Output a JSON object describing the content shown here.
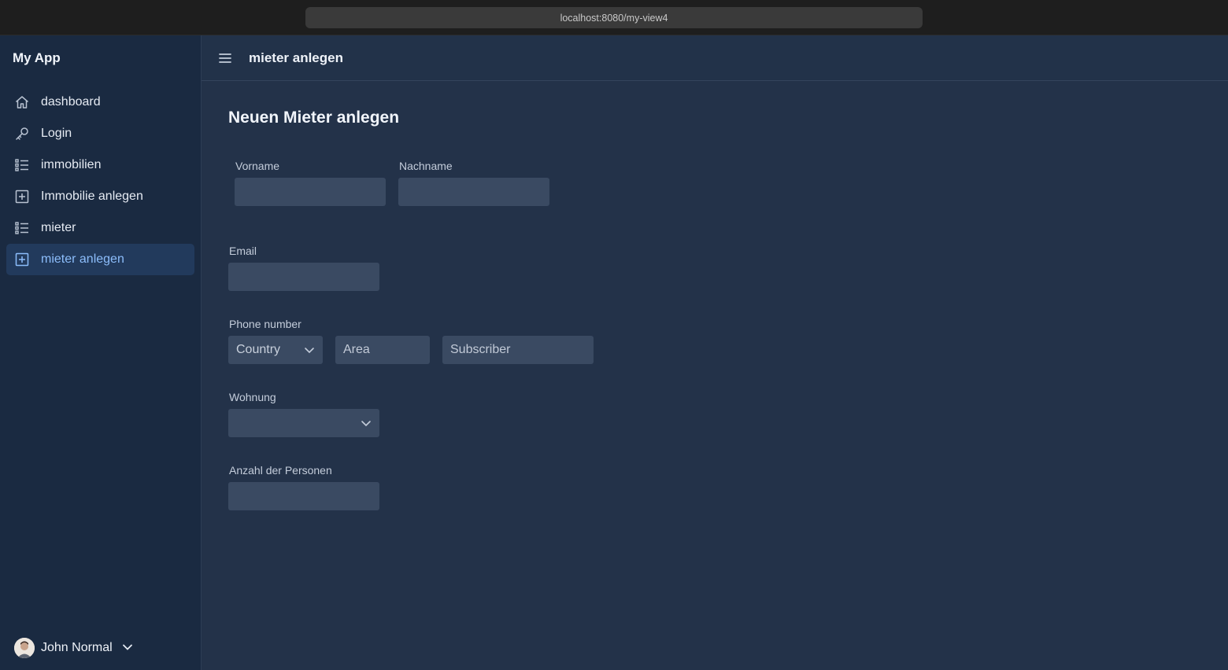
{
  "browser": {
    "url": "localhost:8080/my-view4"
  },
  "app": {
    "title": "My App"
  },
  "nav": [
    {
      "label": "dashboard",
      "icon": "home-icon",
      "active": false
    },
    {
      "label": "Login",
      "icon": "key-icon",
      "active": false
    },
    {
      "label": "immobilien",
      "icon": "list-icon",
      "active": false
    },
    {
      "label": "Immobilie anlegen",
      "icon": "plus-square-icon",
      "active": false
    },
    {
      "label": "mieter",
      "icon": "list-icon",
      "active": false
    },
    {
      "label": "mieter anlegen",
      "icon": "plus-square-icon",
      "active": true
    }
  ],
  "user": {
    "name": "John Normal"
  },
  "topbar": {
    "title": "mieter anlegen"
  },
  "form": {
    "title": "Neuen Mieter anlegen",
    "vorname_label": "Vorname",
    "nachname_label": "Nachname",
    "email_label": "Email",
    "phone_label": "Phone number",
    "phone_country_placeholder": "Country",
    "phone_area_placeholder": "Area",
    "phone_subscriber_placeholder": "Subscriber",
    "wohnung_label": "Wohnung",
    "personen_label": "Anzahl der Personen"
  },
  "colors": {
    "accent": "#8cbdfb",
    "active_bg": "#223a5c",
    "field_bg": "#3a4a62"
  }
}
